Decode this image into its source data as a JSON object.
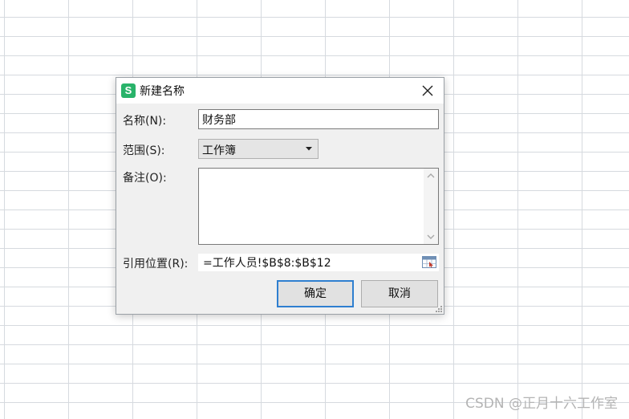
{
  "dialog": {
    "title": "新建名称",
    "app_logo_letter": "S",
    "app_logo_color": "#29b36a",
    "close_icon": "close-icon"
  },
  "form": {
    "name_label": "名称(N):",
    "name_value": "财务部",
    "scope_label": "范围(S):",
    "scope_value": "工作簿",
    "comment_label": "备注(O):",
    "comment_value": "",
    "ref_label": "引用位置(R):",
    "ref_value": "=工作人员!$B$8:$B$12",
    "ref_picker_icon": "range-select-icon"
  },
  "buttons": {
    "ok_label": "确定",
    "cancel_label": "取消",
    "ok_border_color": "#2f7fd0"
  },
  "watermark": {
    "text": "CSDN @正月十六工作室"
  }
}
